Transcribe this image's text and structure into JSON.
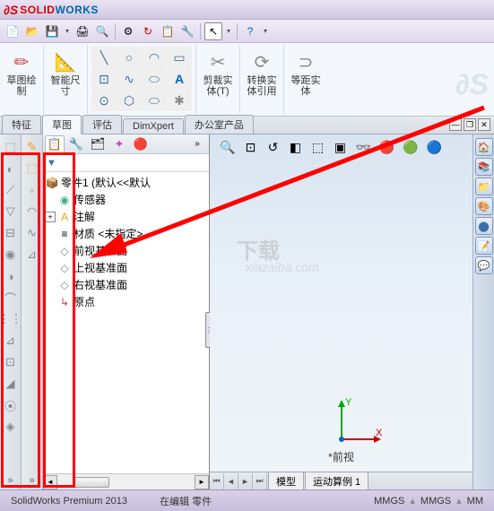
{
  "app": {
    "name_solid": "SOLID",
    "name_works": "WORKS"
  },
  "ribbon": {
    "sketch_draw": "草图绘\n制",
    "smart_dim": "智能尺\n寸",
    "trim": "剪裁实\n体(T)",
    "convert": "转换实\n体引用",
    "offset": "等距实\n体"
  },
  "tabs": {
    "features": "特征",
    "sketch": "草图",
    "evaluate": "评估",
    "dimxpert": "DimXpert",
    "office": "办公室产品"
  },
  "tree": {
    "root": "零件1 (默认<<默认",
    "sensors": "传感器",
    "annotations": "注解",
    "material": "材质 <未指定>",
    "front_plane": "前视基准面",
    "top_plane": "上视基准面",
    "right_plane": "右视基准面",
    "origin": "原点"
  },
  "viewport": {
    "view_label": "*前视",
    "axis_y": "Y",
    "axis_x": "X"
  },
  "bottom_tabs": {
    "model": "模型",
    "motion": "运动算例 1"
  },
  "status": {
    "product": "SolidWorks Premium 2013",
    "mode": "在编辑 零件",
    "units": "MMGS",
    "units2": "MMGS",
    "units3": "MM"
  },
  "watermark": {
    "main": "下载",
    "sub": "xiazaiba.com"
  }
}
